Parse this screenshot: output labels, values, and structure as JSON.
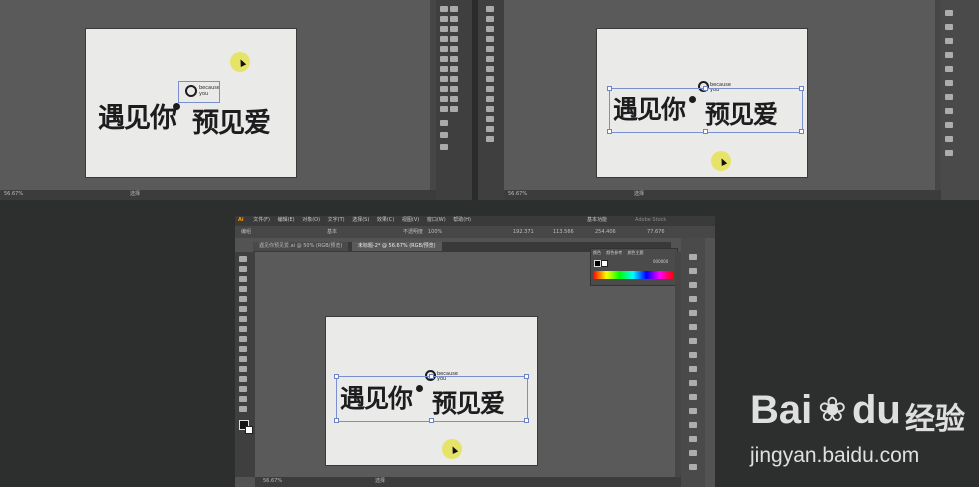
{
  "artwork": {
    "title_text": "遇见你预见爱",
    "title_part1": "遇见你",
    "title_part2": "预见爱",
    "subtitle_line1": "because",
    "subtitle_line2": "you"
  },
  "screenshot_top_left": {
    "zoom": "56.67%",
    "status": "选择"
  },
  "screenshot_top_right": {
    "zoom": "56.67%",
    "status": "选择"
  },
  "screenshot_bottom": {
    "app_logo": "Ai",
    "menu": [
      "文件(F)",
      "编辑(E)",
      "对象(O)",
      "文字(T)",
      "选择(S)",
      "效果(C)",
      "视图(V)",
      "窗口(W)",
      "帮助(H)"
    ],
    "workspace": "基本功能",
    "search_placeholder": "Adobe Stock",
    "control_bar": {
      "label": "编组",
      "stroke_style": "基本",
      "opacity_label": "不透明度",
      "opacity_value": "100%",
      "x_value": "192.371",
      "y_value": "113.566",
      "w_value": "254.406",
      "h_value": "77.676"
    },
    "tabs": [
      {
        "label": "遇见你预见爱.ai @ 50% (RGB/预览)",
        "active": false
      },
      {
        "label": "未标题-2* @ 56.67% (RGB/预览)",
        "active": true
      }
    ],
    "color_panel": {
      "tabs": [
        "颜色",
        "颜色参考",
        "颜色主题"
      ],
      "hex": "000000"
    },
    "zoom": "56.67%",
    "status": "选择"
  },
  "watermark": {
    "brand": "Bai",
    "brand_end": "du",
    "brand_cn": "经验",
    "url": "jingyan.baidu.com"
  },
  "colors": {
    "ui_dark": "#2d2e2e",
    "canvas": "#5a5a5a",
    "artboard": "#eaebe8",
    "highlight": "#e6e35a",
    "selection": "#7a8fcf"
  }
}
